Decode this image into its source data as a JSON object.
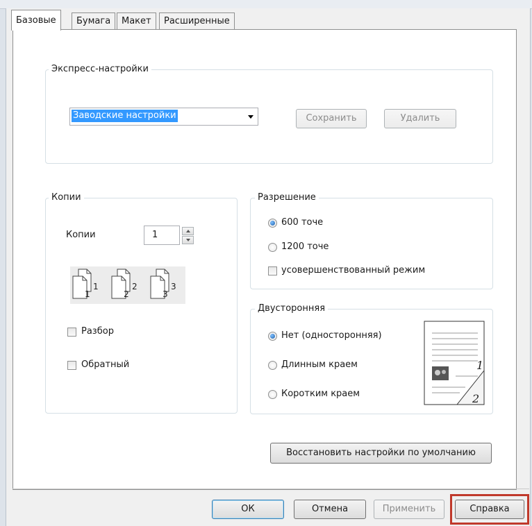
{
  "tabs": [
    {
      "label": "Базовые",
      "active": true
    },
    {
      "label": "Бумага",
      "active": false
    },
    {
      "label": "Макет",
      "active": false
    },
    {
      "label": "Расширенные",
      "active": false
    }
  ],
  "express": {
    "legend": "Экспресс-настройки",
    "preset_value": "Заводские настройки",
    "save_label": "Сохранить",
    "delete_label": "Удалить"
  },
  "copies": {
    "legend": "Копии",
    "label": "Копии",
    "value": "1",
    "collate_label": "Разбор",
    "reverse_label": "Обратный",
    "illustration_pages": [
      "1",
      "1",
      "2",
      "2",
      "3",
      "3"
    ]
  },
  "resolution": {
    "legend": "Разрешение",
    "options": [
      {
        "label": "600 точе",
        "checked": true
      },
      {
        "label": "1200 точе",
        "checked": false
      }
    ],
    "enhanced_label": "усовершенствованный режим"
  },
  "duplex": {
    "legend": "Двусторонняя",
    "options": [
      {
        "label": "Нет (односторонняя)",
        "checked": true
      },
      {
        "label": "Длинным краем",
        "checked": false
      },
      {
        "label": "Коротким краем",
        "checked": false
      }
    ],
    "preview_pages": [
      "1",
      "2"
    ]
  },
  "restore_label": "Восстановить настройки по умолчанию",
  "footer": {
    "ok": "ОК",
    "cancel": "Отмена",
    "apply": "Применить",
    "help": "Справка"
  },
  "colors": {
    "selection": "#3399ff",
    "highlight_frame": "#c0392b"
  }
}
